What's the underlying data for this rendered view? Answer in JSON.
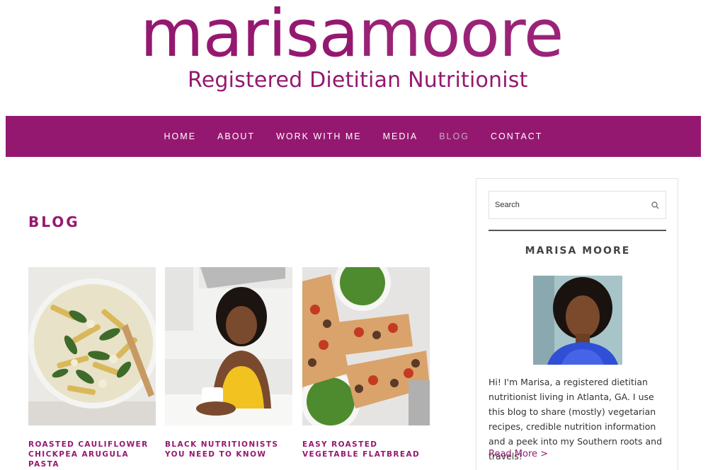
{
  "brand": {
    "name_first": "marisa",
    "name_last": "moore",
    "tagline": "Registered Dietitian Nutritionist",
    "color": "#951870"
  },
  "nav": {
    "items": [
      {
        "label": "HOME"
      },
      {
        "label": "ABOUT"
      },
      {
        "label": "WORK WITH ME"
      },
      {
        "label": "MEDIA"
      },
      {
        "label": "BLOG",
        "active": true
      },
      {
        "label": "CONTACT"
      }
    ]
  },
  "page": {
    "title": "BLOG"
  },
  "posts": [
    {
      "title": "ROASTED CAULIFLOWER CHICKPEA ARUGULA PASTA",
      "image": "pasta-bowl-photo"
    },
    {
      "title": "BLACK NUTRITIONISTS YOU NEED TO KNOW",
      "image": "woman-in-kitchen-photo"
    },
    {
      "title": "EASY ROASTED VEGETABLE FLATBREAD",
      "image": "flatbread-photo"
    }
  ],
  "sidebar": {
    "search_placeholder": "Search",
    "search_icon": "search-icon",
    "heading": "MARISA MOORE",
    "bio": "Hi! I'm Marisa, a registered dietitian nutritionist living in Atlanta, GA. I use this blog to share (mostly) vegetarian recipes, credible nutrition information and a peek into my Southern roots and travels!",
    "read_more": "Read More >"
  }
}
